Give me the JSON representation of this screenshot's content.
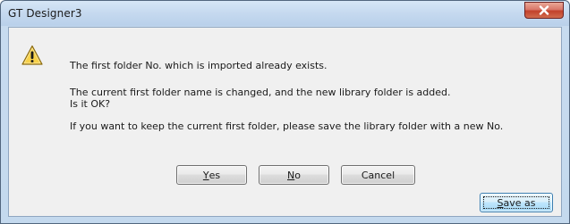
{
  "window": {
    "title": "GT Designer3"
  },
  "dialog": {
    "icon": "warning-icon",
    "message_line1": "The first folder No. which is imported already exists.",
    "message_line2": "The current first folder name is changed, and the new library folder is added.",
    "message_line3": "Is it OK?",
    "message_line4": "If you want to keep the current first folder, please save the library folder with a new No."
  },
  "buttons": {
    "yes": {
      "mnemonic": "Y",
      "rest": "es"
    },
    "no": {
      "mnemonic": "N",
      "rest": "o"
    },
    "cancel": "Cancel",
    "save_as": {
      "mnemonic": "S",
      "rest": "ave as"
    }
  },
  "colors": {
    "close_button": "#c2412b",
    "warning_fill": "#f7d14a",
    "default_button_border": "#3c7fb1"
  }
}
